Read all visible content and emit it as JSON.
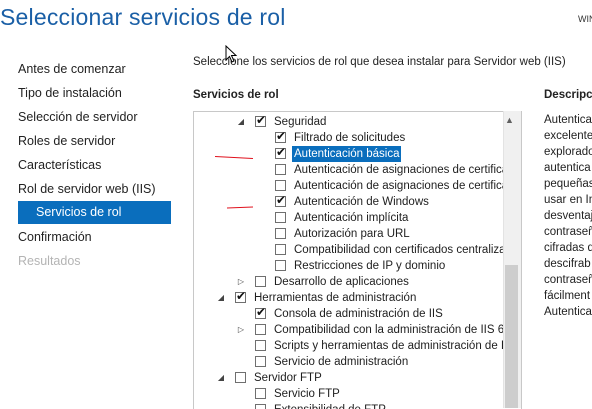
{
  "window": {
    "title": "Seleccionar servicios de rol",
    "server_name": "WIN"
  },
  "nav": {
    "items": [
      {
        "label": "Antes de comenzar",
        "state": "normal"
      },
      {
        "label": "Tipo de instalación",
        "state": "normal"
      },
      {
        "label": "Selección de servidor",
        "state": "normal"
      },
      {
        "label": "Roles de servidor",
        "state": "normal"
      },
      {
        "label": "Características",
        "state": "normal"
      },
      {
        "label": "Rol de servidor web (IIS)",
        "state": "normal"
      },
      {
        "label": "Servicios de rol",
        "state": "selected"
      },
      {
        "label": "Confirmación",
        "state": "normal"
      },
      {
        "label": "Resultados",
        "state": "disabled"
      }
    ]
  },
  "main": {
    "instruction": "Seleccione los servicios de rol que desea instalar para Servidor web (IIS)",
    "services_header": "Servicios de rol",
    "description_header": "Descripci",
    "tree": [
      {
        "label": "Seguridad",
        "checked": true,
        "expander": "expanded"
      },
      {
        "label": "Filtrado de solicitudes",
        "checked": true,
        "expander": ""
      },
      {
        "label": "Autenticación básica",
        "checked": true,
        "expander": "",
        "selected": true
      },
      {
        "label": "Autenticación de asignaciones de certificad",
        "checked": false,
        "expander": ""
      },
      {
        "label": "Autenticación de asignaciones de certificad",
        "checked": false,
        "expander": ""
      },
      {
        "label": "Autenticación de Windows",
        "checked": true,
        "expander": ""
      },
      {
        "label": "Autenticación implícita",
        "checked": false,
        "expander": ""
      },
      {
        "label": "Autorización para URL",
        "checked": false,
        "expander": ""
      },
      {
        "label": "Compatibilidad con certificados centralizad",
        "checked": false,
        "expander": ""
      },
      {
        "label": "Restricciones de IP y dominio",
        "checked": false,
        "expander": ""
      },
      {
        "label": "Desarrollo de aplicaciones",
        "checked": false,
        "expander": "collapsed"
      },
      {
        "label": "Herramientas de administración",
        "checked": true,
        "expander": "expanded"
      },
      {
        "label": "Consola de administración de IIS",
        "checked": true,
        "expander": ""
      },
      {
        "label": "Compatibilidad con la administración de IIS 6",
        "checked": false,
        "expander": "collapsed"
      },
      {
        "label": "Scripts y herramientas de administración de IIS",
        "checked": false,
        "expander": ""
      },
      {
        "label": "Servicio de administración",
        "checked": false,
        "expander": ""
      },
      {
        "label": "Servidor FTP",
        "checked": false,
        "expander": "expanded"
      },
      {
        "label": "Servicio FTP",
        "checked": false,
        "expander": ""
      },
      {
        "label": "Extensibilidad de FTP",
        "checked": false,
        "expander": ""
      }
    ],
    "description_lines": [
      "Autentica",
      "excelente",
      "explorado",
      "autentica",
      "pequeñas",
      "usar en In",
      "desventaj",
      "contraseñ",
      "cifradas d",
      "descifrab",
      "contraseñ",
      "fácilment",
      "Autentica"
    ]
  },
  "icons": {
    "checkmark": "check-icon",
    "expanded": "triangle-down-icon",
    "collapsed": "triangle-right-icon",
    "cursor": "mouse-pointer-icon"
  },
  "colors": {
    "title": "#1a5fa6",
    "selection": "#0a6ebd",
    "annotation": "#e0101c"
  }
}
